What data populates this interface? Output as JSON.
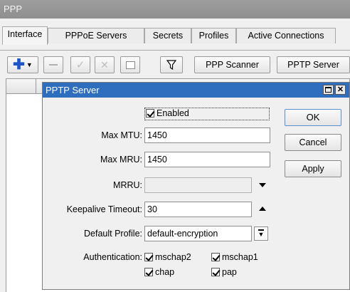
{
  "window": {
    "title": "PPP"
  },
  "tabs": [
    "Interface",
    "PPPoE Servers",
    "Secrets",
    "Profiles",
    "Active Connections"
  ],
  "toolbar": {
    "scanner_label": "PPP Scanner",
    "pptp_label": "PPTP Server"
  },
  "dialog": {
    "title": "PPTP Server",
    "enabled_label": "Enabled",
    "fields": {
      "max_mtu": {
        "label": "Max MTU:",
        "value": "1450"
      },
      "max_mru": {
        "label": "Max MRU:",
        "value": "1450"
      },
      "mrru": {
        "label": "MRRU:",
        "value": ""
      },
      "keepalive": {
        "label": "Keepalive Timeout:",
        "value": "30"
      },
      "default_profile": {
        "label": "Default Profile:",
        "value": "default-encryption"
      }
    },
    "auth": {
      "label": "Authentication:",
      "options": [
        "mschap2",
        "mschap1",
        "chap",
        "pap"
      ]
    },
    "buttons": {
      "ok": "OK",
      "cancel": "Cancel",
      "apply": "Apply"
    }
  },
  "colors": {
    "title_bar": "#2f6dbf",
    "add_icon": "#1b55c9"
  }
}
